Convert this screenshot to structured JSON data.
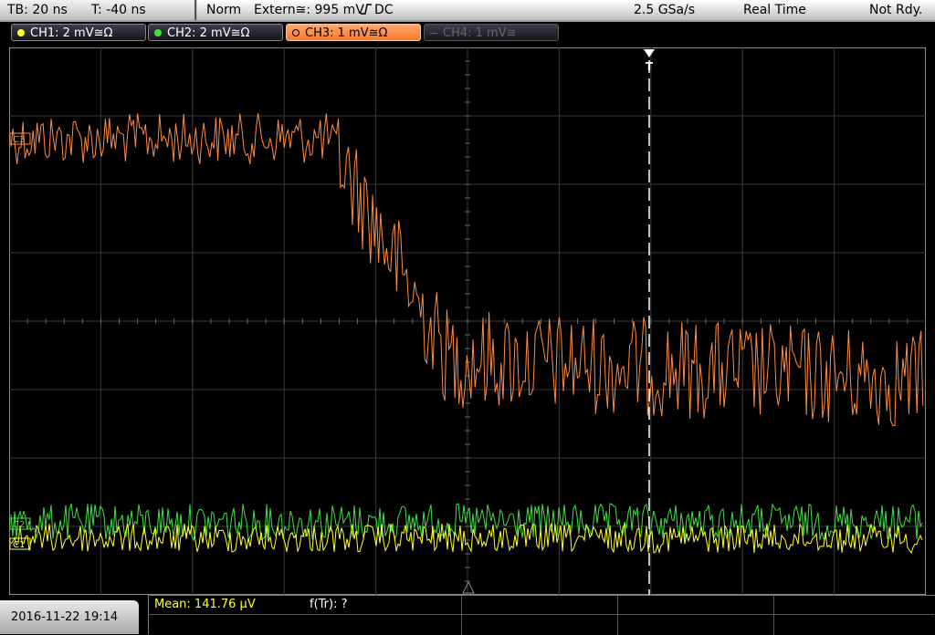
{
  "header": {
    "timebase": "TB: 20 ns",
    "trigger_time": "T: -40 ns",
    "trigger_mode": "Norm",
    "trigger_source": "Extern≅: 995 mV",
    "trigger_coupling": "DC",
    "sample_rate": "2.5 GSa/s",
    "acquisition_mode": "Real Time",
    "status": "Not Rdy."
  },
  "channels": [
    {
      "label": "CH1: 2 mV≅Ω",
      "color": "#ffff30",
      "active": false,
      "enabled": true
    },
    {
      "label": "CH2: 2 mV≅Ω",
      "color": "#40e040",
      "active": false,
      "enabled": true
    },
    {
      "label": "CH3: 1 mV≅Ω",
      "color": "#ff8c40",
      "active": true,
      "enabled": true
    },
    {
      "label": "CH4: 1 mV≅",
      "color": "#555555",
      "active": false,
      "enabled": false
    }
  ],
  "markers": {
    "ch3": "C3",
    "ch2": "C2",
    "ch1": "C1",
    "trigger": "T"
  },
  "footer": {
    "datetime": "2016-11-22 19:14",
    "measurement_1": "Mean: 141.76 µV",
    "measurement_2": "f(Tr): ?"
  }
}
